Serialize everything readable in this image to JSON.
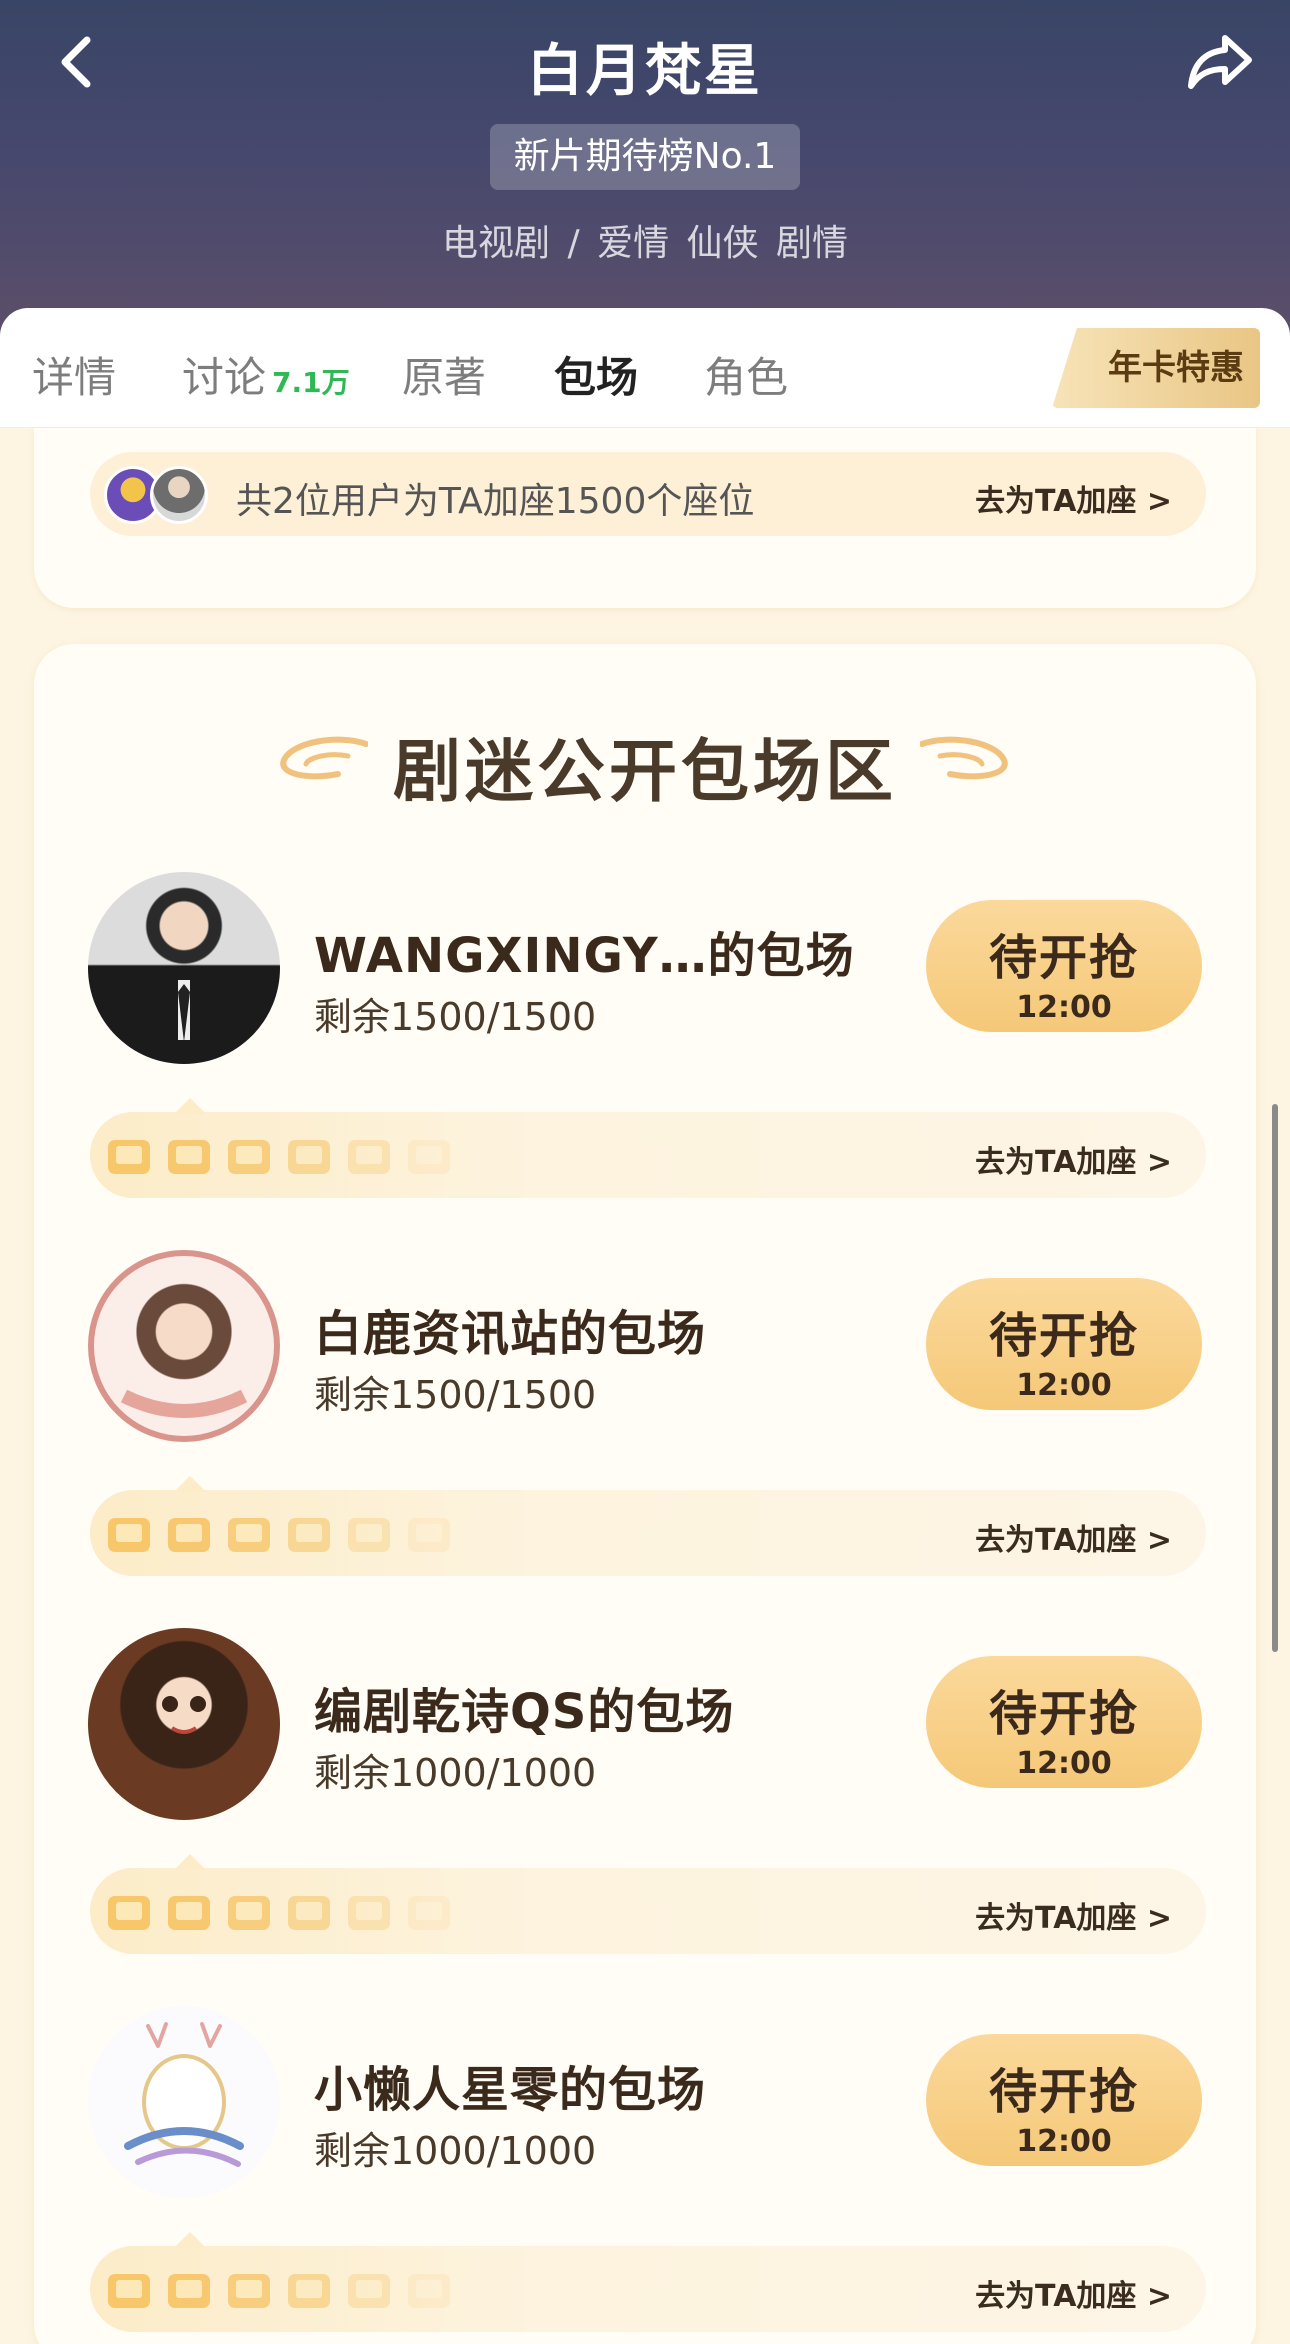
{
  "header": {
    "title": "白月梵星",
    "rank_badge": "新片期待榜No.1",
    "genre": "电视剧 / 爱情 仙侠 剧情"
  },
  "tabs": {
    "details": "详情",
    "discussion": "讨论",
    "discussion_count": "7.1万",
    "original": "原著",
    "booking": "包场",
    "roles": "角色",
    "vip": "年卡特惠"
  },
  "join": {
    "text": "共2位用户为TA加座1500个座位",
    "link": "去为TA加座 >"
  },
  "section": {
    "title": "剧迷公开包场区"
  },
  "items": [
    {
      "name": "WANGXINGY…的包场",
      "remain": "剩余1500/1500",
      "btn": "待开抢",
      "time": "12:00",
      "link": "去为TA加座 >"
    },
    {
      "name": "白鹿资讯站的包场",
      "remain": "剩余1500/1500",
      "btn": "待开抢",
      "time": "12:00",
      "link": "去为TA加座 >"
    },
    {
      "name": "编剧乾诗QS的包场",
      "remain": "剩余1000/1000",
      "btn": "待开抢",
      "time": "12:00",
      "link": "去为TA加座 >"
    },
    {
      "name": "小懒人星零的包场",
      "remain": "剩余1000/1000",
      "btn": "待开抢",
      "time": "12:00",
      "link": "去为TA加座 >"
    }
  ],
  "colors": {
    "header_top": "#394566",
    "accent_gold": "#f5c878",
    "green_count": "#2fb855"
  }
}
